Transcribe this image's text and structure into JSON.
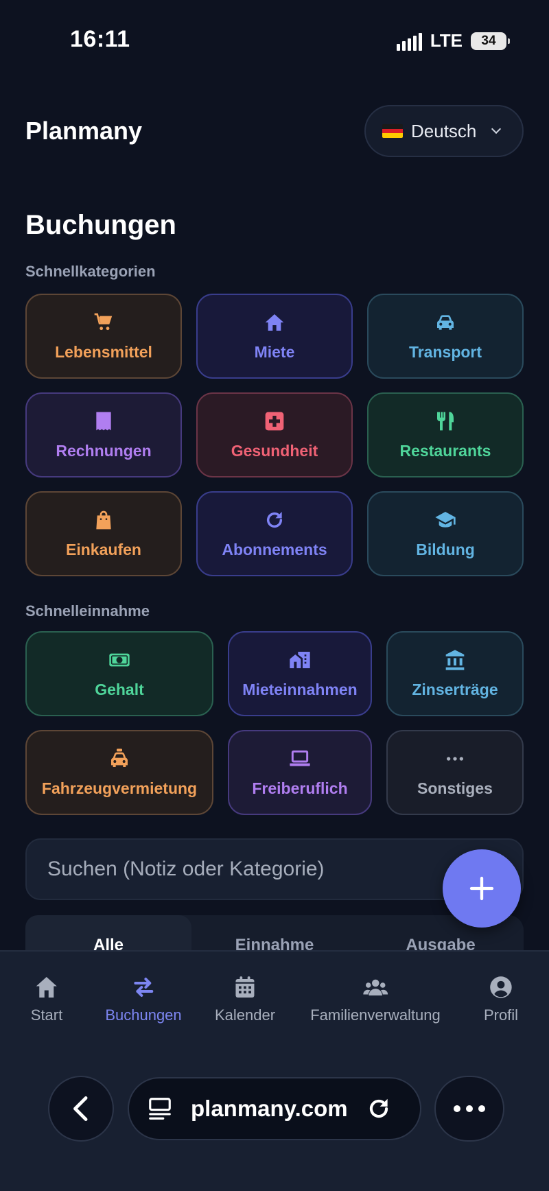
{
  "status_bar": {
    "time": "16:11",
    "network": "LTE",
    "battery": "34"
  },
  "header": {
    "app_title": "Planmany",
    "language": "Deutsch"
  },
  "page": {
    "title": "Buchungen"
  },
  "quick_categories": {
    "label": "Schnellkategorien",
    "items": [
      {
        "label": "Lebensmittel",
        "icon": "cart-icon",
        "color": "#f2a15a"
      },
      {
        "label": "Miete",
        "icon": "home-icon",
        "color": "#7f83f5"
      },
      {
        "label": "Transport",
        "icon": "car-icon",
        "color": "#62b4e2"
      },
      {
        "label": "Rechnungen",
        "icon": "receipt-icon",
        "color": "#b07ef0"
      },
      {
        "label": "Gesundheit",
        "icon": "medical-icon",
        "color": "#f06275"
      },
      {
        "label": "Restaurants",
        "icon": "utensils-icon",
        "color": "#4fd59a"
      },
      {
        "label": "Einkaufen",
        "icon": "shopping-bag-icon",
        "color": "#f2a15a"
      },
      {
        "label": "Abonnements",
        "icon": "refresh-icon",
        "color": "#7f83f5"
      },
      {
        "label": "Bildung",
        "icon": "graduation-cap-icon",
        "color": "#62b4e2"
      }
    ]
  },
  "quick_income": {
    "label": "Schnelleinnahme",
    "items": [
      {
        "label": "Gehalt",
        "icon": "money-icon",
        "color": "#4fd59a"
      },
      {
        "label": "Mieteinnahmen",
        "icon": "building-icon",
        "color": "#7f83f5"
      },
      {
        "label": "Zinserträge",
        "icon": "bank-icon",
        "color": "#62b4e2"
      },
      {
        "label": "Fahrzeugvermietung",
        "icon": "taxi-icon",
        "color": "#f2a15a"
      },
      {
        "label": "Freiberuflich",
        "icon": "laptop-icon",
        "color": "#b07ef0"
      },
      {
        "label": "Sonstiges",
        "icon": "more-icon",
        "color": "#aab0bd"
      }
    ]
  },
  "search": {
    "placeholder": "Suchen (Notiz oder Kategorie)"
  },
  "filter_tabs": [
    "Alle",
    "Einnahme",
    "Ausgabe"
  ],
  "bottom_nav": [
    {
      "label": "Start",
      "icon": "home-icon"
    },
    {
      "label": "Buchungen",
      "icon": "transfer-icon",
      "active": true
    },
    {
      "label": "Kalender",
      "icon": "calendar-icon"
    },
    {
      "label": "Familienverwaltung",
      "icon": "users-icon"
    },
    {
      "label": "Profil",
      "icon": "user-circle-icon"
    }
  ],
  "browser": {
    "url": "planmany.com"
  }
}
